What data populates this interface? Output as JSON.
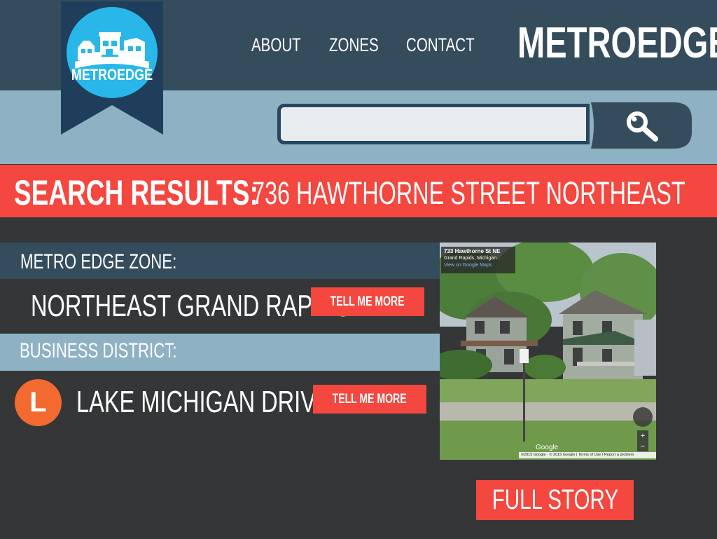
{
  "header": {
    "logo_text": "METROEDGE",
    "nav": [
      {
        "label": "ABOUT"
      },
      {
        "label": "ZONES"
      },
      {
        "label": "CONTACT"
      }
    ],
    "brand_title": "METROEDGE"
  },
  "search": {
    "value": "",
    "placeholder": "",
    "button_icon": "search-icon"
  },
  "results": {
    "label": "SEARCH RESULTS:",
    "address": "736 HAWTHORNE STREET NORTHEAST"
  },
  "zone": {
    "label": "METRO EDGE ZONE:",
    "name": "NORTHEAST GRAND RAPIDS",
    "button_label": "TELL ME MORE"
  },
  "district": {
    "label": "BUSINESS DISTRICT:",
    "badge_letter": "L",
    "name": "LAKE MICHIGAN DRIVE",
    "button_label": "TELL ME MORE"
  },
  "photo": {
    "caption_title": "733 Hawthorne St NE",
    "caption_subtitle": "Grand Rapids, Michigan",
    "caption_link": "View on Google Maps",
    "watermark": "Google",
    "copyright": "©2015 Google · © 2015 Google  |  Terms of Use  |  Report a problem"
  },
  "full_story": {
    "label": "FULL STORY"
  },
  "colors": {
    "header_dark": "#354c5d",
    "header_light": "#8eb1c4",
    "accent_red": "#f4473f",
    "logo_blue": "#29b6e8",
    "background": "#353637",
    "badge_orange": "#f26a2f"
  }
}
